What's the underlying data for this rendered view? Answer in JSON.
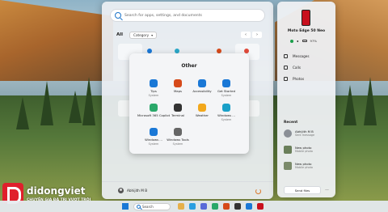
{
  "start_menu": {
    "search_placeholder": "Search for apps, settings, and documents",
    "all_label": "All",
    "category_label": "Category",
    "user_name": "Abhijith M B"
  },
  "folder": {
    "title": "Other",
    "apps": [
      {
        "name": "Tips",
        "sub": "System",
        "icon": "tips-icon",
        "color": "#1a78d6"
      },
      {
        "name": "Maps",
        "sub": "",
        "icon": "maps-icon",
        "color": "#d64a1a"
      },
      {
        "name": "Accessibility",
        "sub": "",
        "icon": "accessibility-icon",
        "color": "#1a78d6"
      },
      {
        "name": "Get Started",
        "sub": "System",
        "icon": "get-started-icon",
        "color": "#1a78d6"
      },
      {
        "name": "Microsoft 365 Copilot",
        "sub": "",
        "icon": "copilot-icon",
        "color": "#2aa86a"
      },
      {
        "name": "Terminal",
        "sub": "",
        "icon": "terminal-icon",
        "color": "#333333"
      },
      {
        "name": "Weather",
        "sub": "",
        "icon": "weather-icon",
        "color": "#f2a81c"
      },
      {
        "name": "Windows ...",
        "sub": "System",
        "icon": "windows-backup-icon",
        "color": "#1aa0c8"
      },
      {
        "name": "Windows ...",
        "sub": "System",
        "icon": "windows-media-icon",
        "color": "#1a78d6"
      },
      {
        "name": "Windows Tools",
        "sub": "System",
        "icon": "windows-tools-icon",
        "color": "#666666"
      }
    ]
  },
  "phone": {
    "device_name": "Moto Edge 50 Neo",
    "battery": "97%",
    "items": [
      "Messages",
      "Calls",
      "Photos"
    ],
    "recent_title": "Recent",
    "recent": [
      {
        "title": "Abhijith M B",
        "sub": "Sent message"
      },
      {
        "title": "New photo",
        "sub": "Mobile photo"
      },
      {
        "title": "New photo",
        "sub": "Mobile photo"
      }
    ],
    "send_files": "Send files",
    "more": "..."
  },
  "taskbar": {
    "search_label": "Search"
  },
  "watermark": {
    "brand": "didongviet",
    "tagline": "CHUYÊN GIA ĐÃ TRỊ VƯỢT TRỘI"
  },
  "colors": {
    "accent": "#1a78d6",
    "phone_red": "#c8101e",
    "logo_red": "#e0202c"
  }
}
